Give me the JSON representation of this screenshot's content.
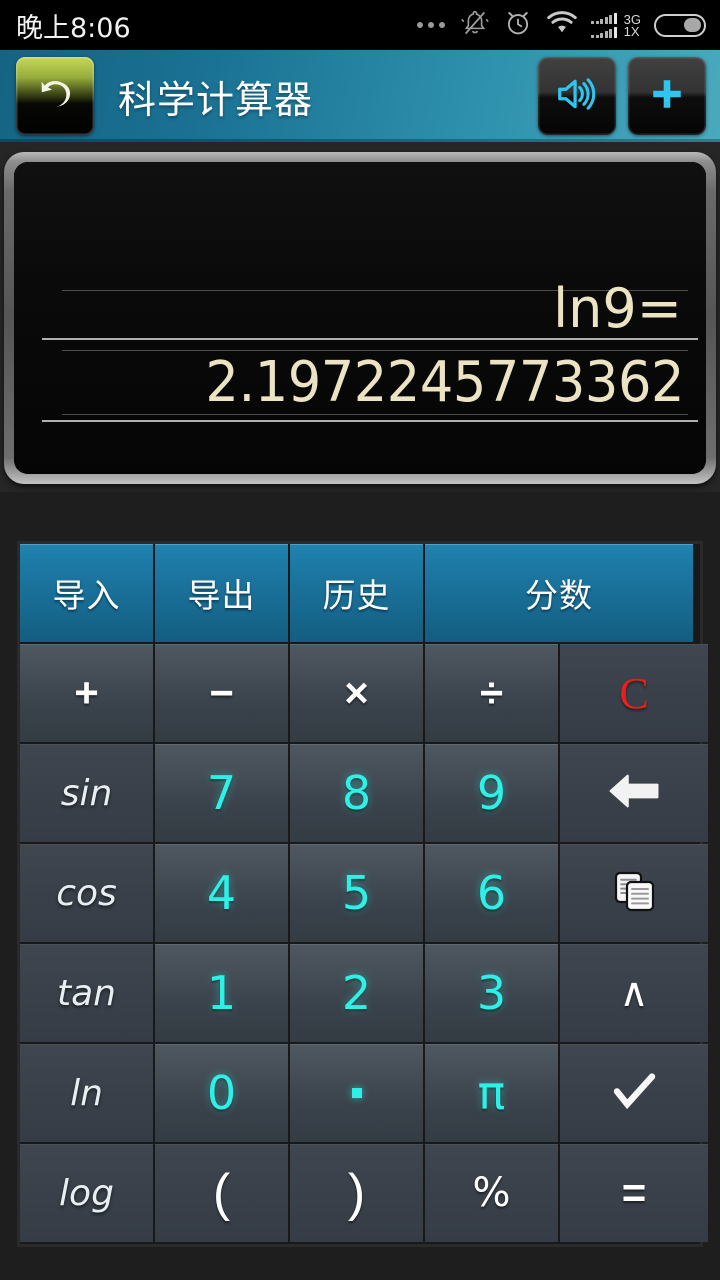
{
  "statusbar": {
    "time": "晚上8:06",
    "icons": [
      "more-dots",
      "silent-bell",
      "alarm-clock",
      "wifi",
      "signal",
      "network-3g-1x",
      "battery"
    ],
    "network_top": "3G",
    "network_bottom": "1X"
  },
  "titlebar": {
    "title": "科学计算器",
    "back_icon": "back-arrow-icon",
    "sound_icon": "speaker-icon",
    "add_icon": "plus-icon"
  },
  "display": {
    "expression": "ln9=",
    "result": "2.1972245773362",
    "text_color": "#ece3c2",
    "background": "#0b0b0b"
  },
  "keypad": {
    "rows": [
      {
        "style": "blue",
        "keys": [
          {
            "label": "导入",
            "name": "import-button"
          },
          {
            "label": "导出",
            "name": "export-button"
          },
          {
            "label": "历史",
            "name": "history-button"
          },
          {
            "label": "分数",
            "name": "fraction-button"
          }
        ]
      },
      {
        "style": "ops",
        "keys": [
          {
            "label": "+",
            "name": "plus-button"
          },
          {
            "label": "−",
            "name": "minus-button"
          },
          {
            "label": "×",
            "name": "multiply-button"
          },
          {
            "label": "÷",
            "name": "divide-button"
          },
          {
            "label": "C",
            "name": "clear-button"
          }
        ]
      },
      {
        "style": "nums",
        "keys": [
          {
            "label": "sin",
            "name": "sin-button"
          },
          {
            "label": "7",
            "name": "digit-7-button"
          },
          {
            "label": "8",
            "name": "digit-8-button"
          },
          {
            "label": "9",
            "name": "digit-9-button"
          },
          {
            "label": "",
            "name": "backspace-button",
            "icon": "left-arrow-icon"
          }
        ]
      },
      {
        "style": "nums",
        "keys": [
          {
            "label": "cos",
            "name": "cos-button"
          },
          {
            "label": "4",
            "name": "digit-4-button"
          },
          {
            "label": "5",
            "name": "digit-5-button"
          },
          {
            "label": "6",
            "name": "digit-6-button"
          },
          {
            "label": "",
            "name": "copy-button",
            "icon": "copy-icon"
          }
        ]
      },
      {
        "style": "nums",
        "keys": [
          {
            "label": "tan",
            "name": "tan-button"
          },
          {
            "label": "1",
            "name": "digit-1-button"
          },
          {
            "label": "2",
            "name": "digit-2-button"
          },
          {
            "label": "3",
            "name": "digit-3-button"
          },
          {
            "label": "∧",
            "name": "power-button"
          }
        ]
      },
      {
        "style": "nums",
        "keys": [
          {
            "label": "ln",
            "name": "ln-button"
          },
          {
            "label": "0",
            "name": "digit-0-button"
          },
          {
            "label": "·",
            "name": "decimal-point-button"
          },
          {
            "label": "π",
            "name": "pi-button"
          },
          {
            "label": "",
            "name": "sqrt-button",
            "icon": "check-icon"
          }
        ]
      },
      {
        "style": "nums",
        "keys": [
          {
            "label": "log",
            "name": "log-button"
          },
          {
            "label": "(",
            "name": "left-paren-button"
          },
          {
            "label": ")",
            "name": "right-paren-button"
          },
          {
            "label": "%",
            "name": "percent-button"
          },
          {
            "label": "=",
            "name": "equals-button"
          }
        ]
      }
    ]
  },
  "colors": {
    "accent_blue": "#1c79a4",
    "digit_cyan": "#2ff0e6",
    "clear_red": "#e8201d",
    "display_text": "#ece3c2",
    "titlebar_left": "#156484",
    "titlebar_right": "#4aa9bd"
  }
}
